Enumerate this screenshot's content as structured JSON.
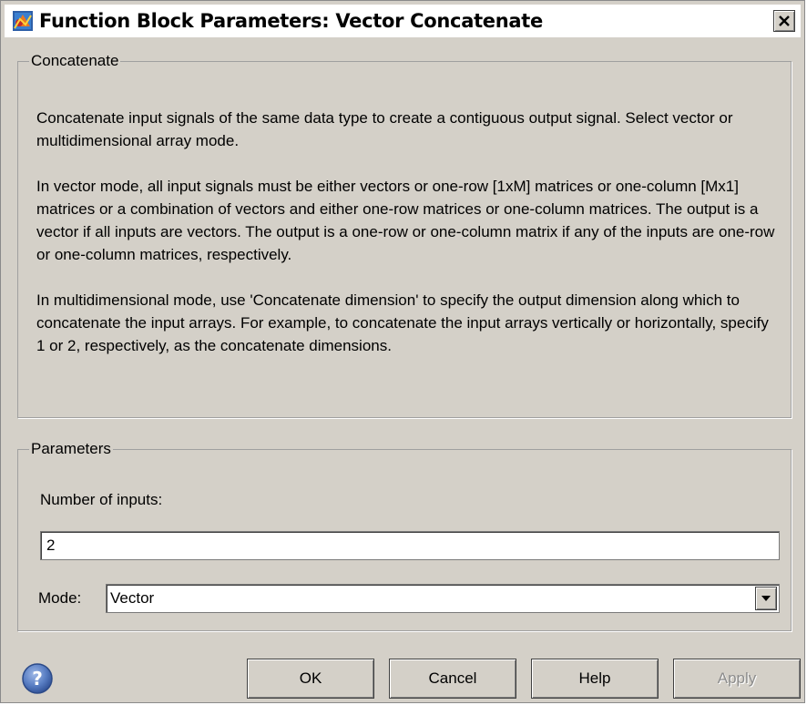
{
  "window": {
    "title": "Function Block Parameters: Vector Concatenate"
  },
  "concatenate": {
    "legend": "Concatenate",
    "paragraphs": [
      "Concatenate input signals of the same data type to create a contiguous output signal. Select vector or multidimensional array mode.",
      "In vector mode, all input signals must be either vectors or one-row [1xM] matrices or one-column [Mx1] matrices or a combination of vectors and either one-row matrices or one-column matrices. The output is a vector if all inputs are vectors. The output is a one-row or one-column matrix if any of the inputs are one-row or one-column matrices, respectively.",
      "In multidimensional mode, use 'Concatenate dimension' to specify the output dimension along which to concatenate the input arrays. For example, to concatenate the input arrays vertically or horizontally, specify 1 or 2, respectively, as the concatenate dimensions."
    ]
  },
  "parameters": {
    "legend": "Parameters",
    "num_inputs_label": "Number of inputs:",
    "num_inputs_value": "2",
    "mode_label": "Mode:",
    "mode_value": "Vector"
  },
  "buttons": {
    "ok": "OK",
    "cancel": "Cancel",
    "help": "Help",
    "apply": "Apply"
  },
  "icons": {
    "title": "simulink-block-icon",
    "close": "close-icon",
    "help": "help-question-icon",
    "dropdown": "chevron-down-icon"
  },
  "colors": {
    "dialog_bg": "#d4d0c8",
    "help_icon": "#4a6fb5",
    "disabled_text": "#8c8c8c"
  }
}
